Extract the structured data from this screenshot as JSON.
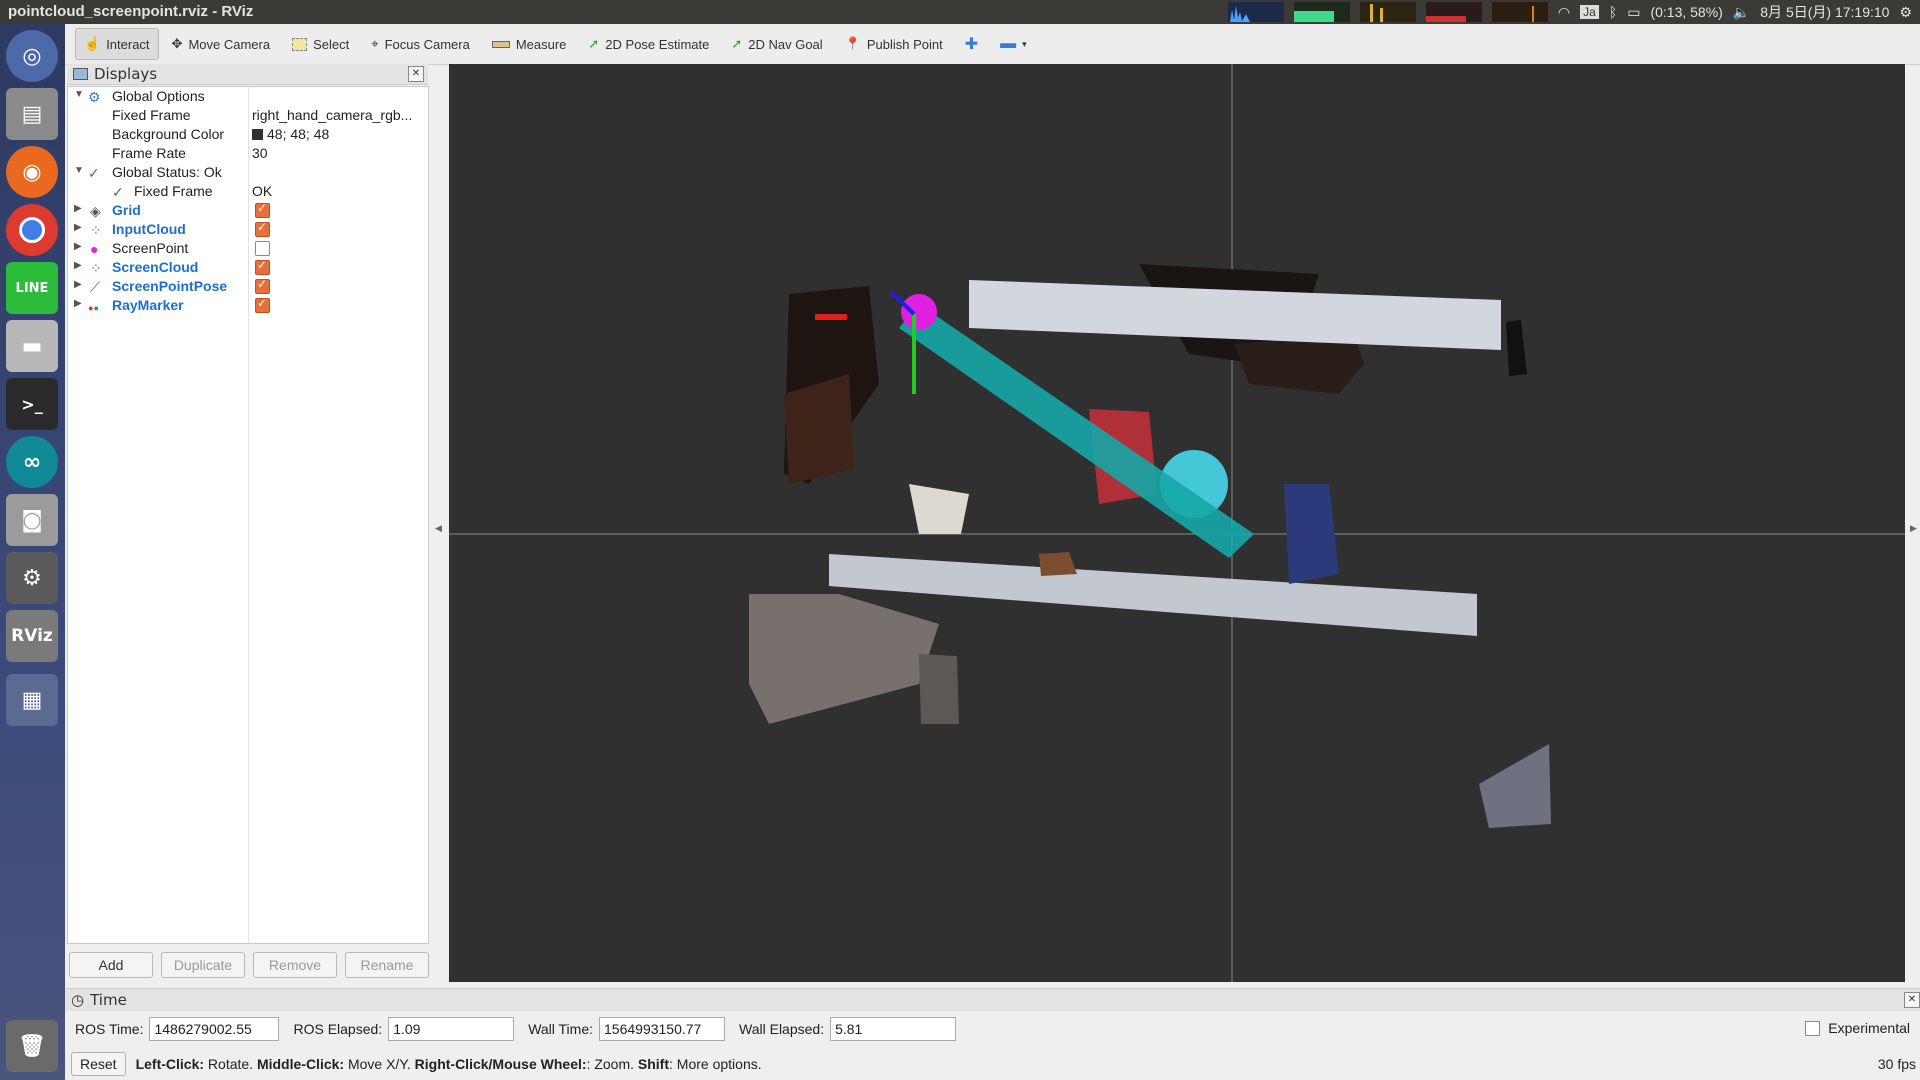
{
  "window": {
    "title": "pointcloud_screenpoint.rviz - RViz"
  },
  "tray": {
    "battery": "(0:13, 58%)",
    "lang": "Ja",
    "clock": "8月 5日(月) 17:19:10"
  },
  "launcher": [
    "ubuntu-icon",
    "files-icon",
    "firefox-icon",
    "chrome-icon",
    "line-icon",
    "disk-icon",
    "terminal-icon",
    "arduino-icon",
    "camera-icon",
    "settings-icon",
    "rviz-icon",
    "workspace-icon",
    "trash-icon"
  ],
  "toolbar": {
    "interact": "Interact",
    "move_camera": "Move Camera",
    "select": "Select",
    "focus_camera": "Focus Camera",
    "measure": "Measure",
    "pose_estimate": "2D Pose Estimate",
    "nav_goal": "2D Nav Goal",
    "publish_point": "Publish Point"
  },
  "displays": {
    "title": "Displays",
    "global_options": "Global Options",
    "fixed_frame_label": "Fixed Frame",
    "fixed_frame_value": "right_hand_camera_rgb...",
    "bg_color_label": "Background Color",
    "bg_color_value": "48; 48; 48",
    "frame_rate_label": "Frame Rate",
    "frame_rate_value": "30",
    "global_status": "Global Status: Ok",
    "status_fixed_frame": "Fixed Frame",
    "status_value": "OK",
    "items": [
      {
        "label": "Grid",
        "checked": true
      },
      {
        "label": "InputCloud",
        "checked": true
      },
      {
        "label": "ScreenPoint",
        "checked": false
      },
      {
        "label": "ScreenCloud",
        "checked": true
      },
      {
        "label": "ScreenPointPose",
        "checked": true
      },
      {
        "label": "RayMarker",
        "checked": true
      }
    ],
    "buttons": {
      "add": "Add",
      "duplicate": "Duplicate",
      "remove": "Remove",
      "rename": "Rename"
    }
  },
  "time": {
    "title": "Time",
    "ros_time_label": "ROS Time:",
    "ros_time": "1486279002.55",
    "ros_elapsed_label": "ROS Elapsed:",
    "ros_elapsed": "1.09",
    "wall_time_label": "Wall Time:",
    "wall_time": "1564993150.77",
    "wall_elapsed_label": "Wall Elapsed:",
    "wall_elapsed": "5.81",
    "experimental": "Experimental"
  },
  "status": {
    "reset": "Reset",
    "h1": "Left-Click:",
    "t1": " Rotate. ",
    "h2": "Middle-Click:",
    "t2": " Move X/Y. ",
    "h3": "Right-Click/Mouse Wheel:",
    "t3": ": Zoom. ",
    "h4": "Shift",
    "t4": ": More options.",
    "fps": "30 fps"
  }
}
